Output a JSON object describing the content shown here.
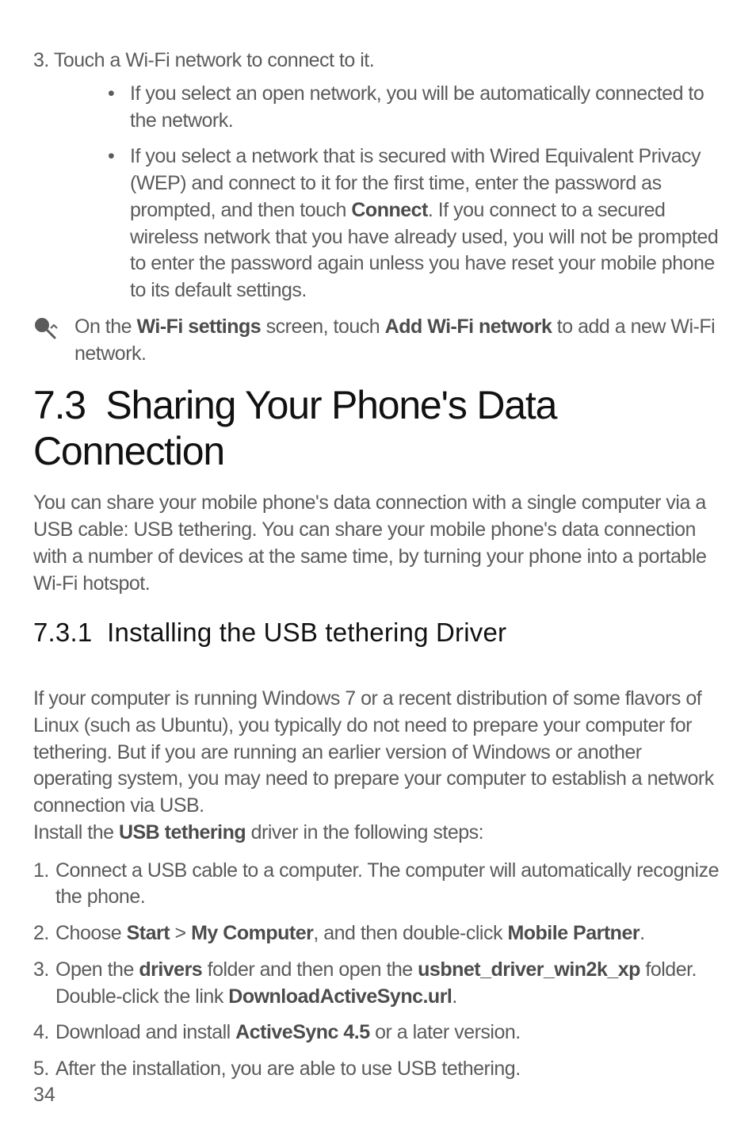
{
  "continued_list": {
    "num": "3.",
    "text": "Touch a Wi-Fi network to connect to it.",
    "bullets": [
      {
        "text_parts": [
          "If you select an open network, you will be automatically connected to the network."
        ]
      },
      {
        "text_parts": [
          "If you select a network that is secured with Wired Equivalent Privacy (WEP) and connect to it for the first time, enter the password as prompted, and then touch ",
          "Connect",
          ". If you connect to a secured wireless network that you have already used, you will not be prompted to enter the password again unless you have reset your mobile phone to its default settings."
        ]
      }
    ]
  },
  "tip": {
    "parts": [
      "On the ",
      "Wi-Fi settings",
      " screen, touch ",
      "Add Wi-Fi network",
      " to add a new Wi-Fi network."
    ]
  },
  "section": {
    "number": "7.3",
    "title": "Sharing Your Phone's Data Connection"
  },
  "section_intro": "You can share your mobile phone's data connection with a single computer via a USB cable: USB tethering. You can share your mobile phone's data connection with a number of devices at the same time, by turning your phone into a portable Wi-Fi hotspot.",
  "subsection": {
    "number": "7.3.1",
    "title": "Installing the USB tethering Driver"
  },
  "subsection_intro_parts": [
    "If your computer is running Windows 7 or a recent distribution of some flavors of Linux (such as Ubuntu), you typically do not need to prepare your computer for tethering. But if you are running an earlier version of Windows or another operating system, you may need to prepare your computer to establish a network connection via USB.\nInstall the ",
    "USB tethering",
    " driver in the following steps:"
  ],
  "steps": [
    {
      "num": "1.",
      "parts": [
        "Connect a USB cable to a computer. The computer will automatically recognize the phone."
      ]
    },
    {
      "num": "2.",
      "parts": [
        "Choose ",
        "Start",
        " > ",
        "My Computer",
        ", and then double-click ",
        "Mobile Partner",
        "."
      ]
    },
    {
      "num": "3.",
      "parts": [
        "Open the ",
        "drivers",
        " folder and then open the ",
        "usbnet_driver_win2k_xp",
        " folder. Double-click the link ",
        "DownloadActiveSync.url",
        "."
      ]
    },
    {
      "num": "4.",
      "parts": [
        "Download and install ",
        "ActiveSync 4.5",
        " or a later version."
      ]
    },
    {
      "num": "5.",
      "parts": [
        "After the installation, you are able to use USB tethering."
      ]
    }
  ],
  "page_number": "34"
}
